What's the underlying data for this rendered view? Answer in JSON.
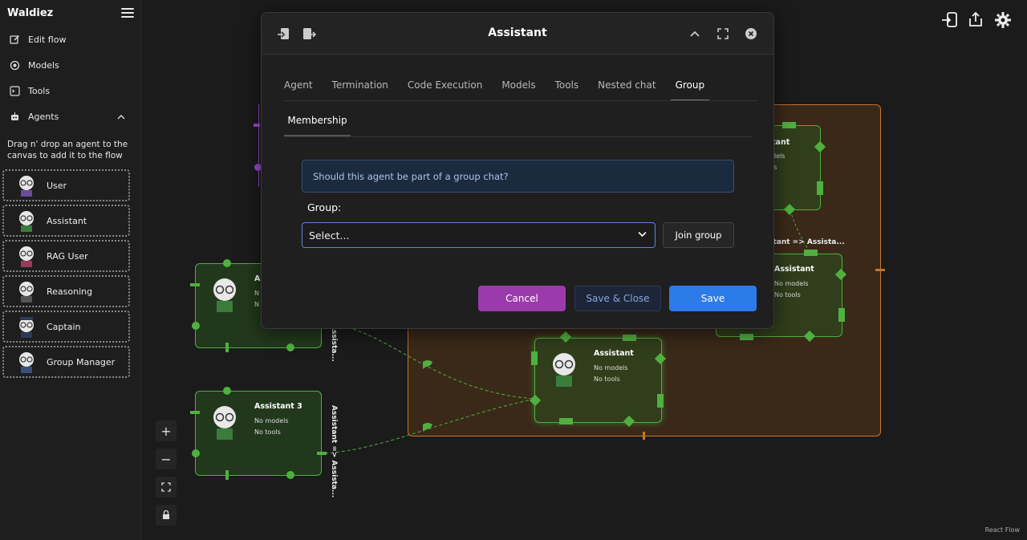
{
  "app": {
    "title": "Waldiez"
  },
  "sidebar": {
    "nav": [
      {
        "label": "Edit flow",
        "icon": "edit-icon"
      },
      {
        "label": "Models",
        "icon": "models-icon"
      },
      {
        "label": "Tools",
        "icon": "terminal-icon"
      },
      {
        "label": "Agents",
        "icon": "robot-icon"
      }
    ],
    "hint": "Drag n' drop an agent to the canvas to add it to the flow",
    "agents": [
      {
        "label": "User"
      },
      {
        "label": "Assistant"
      },
      {
        "label": "RAG User"
      },
      {
        "label": "Reasoning"
      },
      {
        "label": "Captain"
      },
      {
        "label": "Group Manager"
      }
    ]
  },
  "canvas": {
    "nodes": [
      {
        "title": "Assistant 3",
        "models": "No models",
        "tools": "No tools"
      },
      {
        "title": "Assistant",
        "models": "No models",
        "tools": "No tools"
      },
      {
        "title": "Assistant",
        "models": "No models",
        "tools": "No tools"
      },
      {
        "title": "tant",
        "models": "dels",
        "tools": "ls"
      }
    ],
    "edge_labels": [
      "Assistant => Assista...",
      "Assista...",
      "istant => Assista..."
    ],
    "attribution": "React Flow",
    "node1_partial": {
      "title": "A",
      "models": "N",
      "tools": "N"
    }
  },
  "modal": {
    "title": "Assistant",
    "tabs": [
      "Agent",
      "Termination",
      "Code Execution",
      "Models",
      "Tools",
      "Nested chat",
      "Group"
    ],
    "active_tab": "Group",
    "subtab": "Membership",
    "question": "Should this agent be part of a group chat?",
    "group_label": "Group:",
    "select_value": "Select...",
    "join_label": "Join group",
    "cancel_label": "Cancel",
    "save_close_label": "Save & Close",
    "save_label": "Save"
  },
  "colors": {
    "accent_blue": "#2c7be8",
    "cancel_purple": "#9b3bab",
    "node_green": "#4fb03f",
    "group_orange": "#c6762a"
  }
}
